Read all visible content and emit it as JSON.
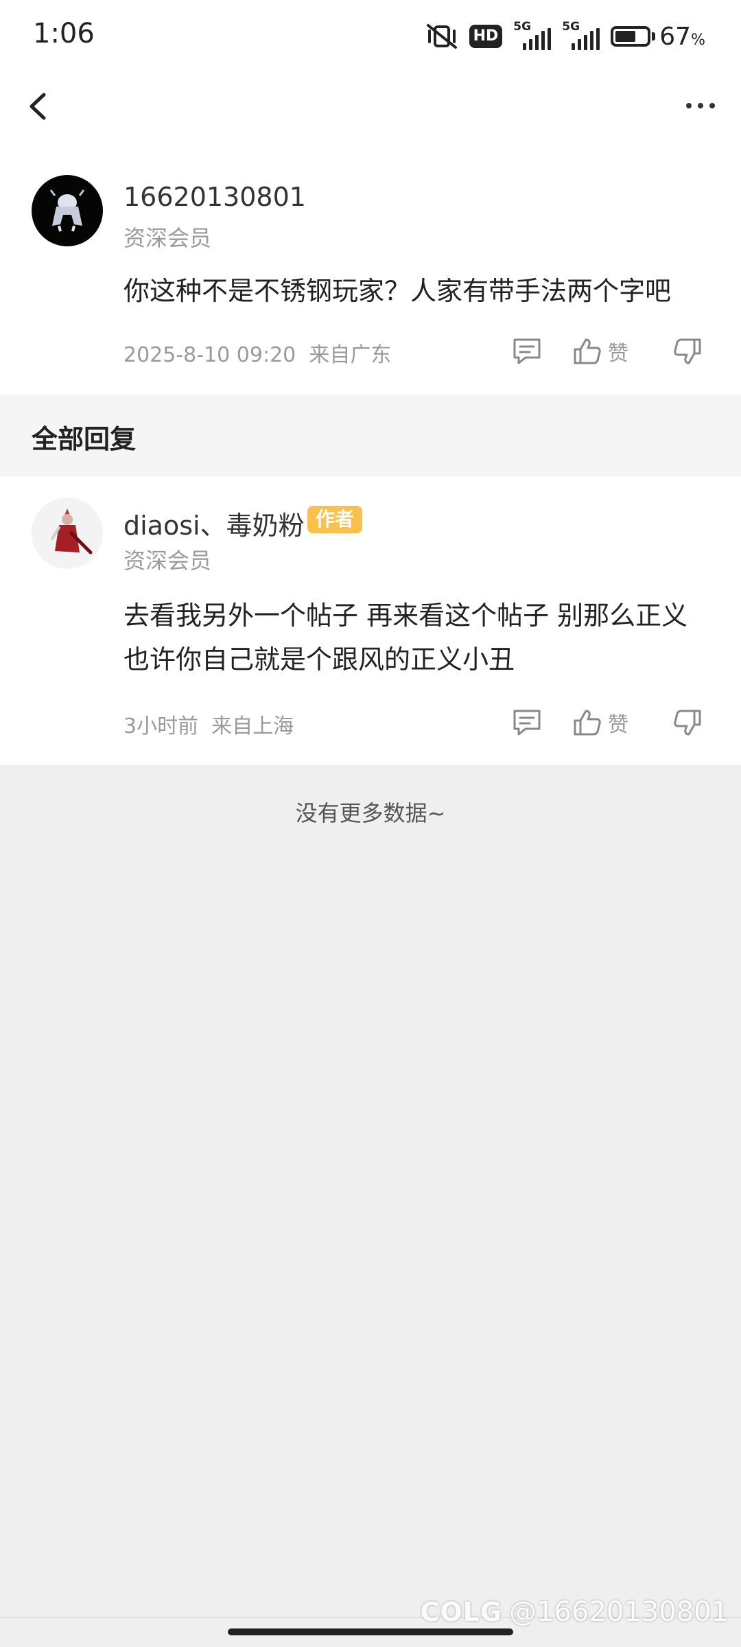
{
  "status_bar": {
    "time": "1:06",
    "hd_label": "HD",
    "net1_label": "5G",
    "net2_label": "5G",
    "battery_percent": "67",
    "battery_unit": "%",
    "battery_level": 0.67
  },
  "nav": {
    "back_icon": "chevron-left-icon",
    "more_icon": "more-horizontal-icon"
  },
  "main_comment": {
    "username": "16620130801",
    "rank": "资深会员",
    "content": "你这种不是不锈钢玩家？人家有带手法两个字吧",
    "time": "2025-8-10 09:20",
    "location": "来自广东",
    "like_label": "赞"
  },
  "section": {
    "title": "全部回复"
  },
  "replies": [
    {
      "username": "diaosi、毒奶粉",
      "badge": "作者",
      "rank": "资深会员",
      "content": "去看我另外一个帖子 再来看这个帖子 别那么正义 也许你自己就是个跟风的正义小丑",
      "time": "3小时前",
      "location": "来自上海",
      "like_label": "赞"
    }
  ],
  "footer": {
    "no_more": "没有更多数据~"
  },
  "watermark": {
    "logo": "COLG",
    "handle": "@16620130801"
  },
  "colors": {
    "badge": "#f8c04c",
    "background": "#efefef",
    "card": "#ffffff"
  }
}
